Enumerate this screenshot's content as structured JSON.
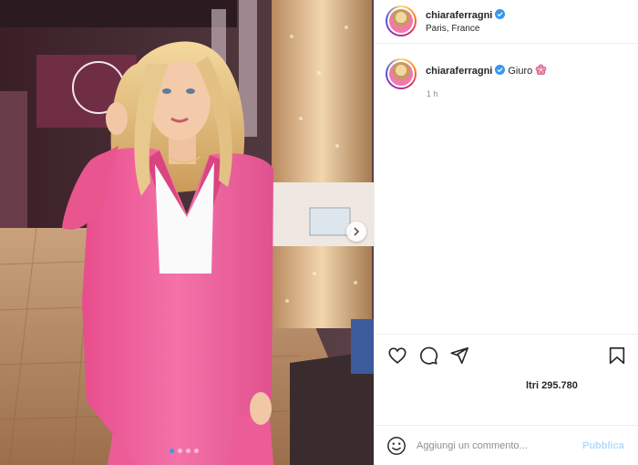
{
  "post": {
    "username": "chiaraferragni",
    "location": "Paris, France",
    "caption_text": "Giuro",
    "caption_emoji": "flower-icon",
    "timestamp": "1 h",
    "likes_text": "ltri 295.780",
    "comment_placeholder": "Aggiungi un commento...",
    "publish_label": "Pubblica",
    "carousel": {
      "count": 4,
      "active_index": 0
    }
  },
  "colors": {
    "verified": "#3897f0",
    "publish_disabled": "#b3dbff",
    "active_dot": "#3797f0",
    "suit_pink": "#f0629e"
  },
  "icons": [
    "verified-badge-icon",
    "heart-icon",
    "comment-icon",
    "share-icon",
    "bookmark-icon",
    "emoji-icon",
    "chevron-right-icon"
  ]
}
